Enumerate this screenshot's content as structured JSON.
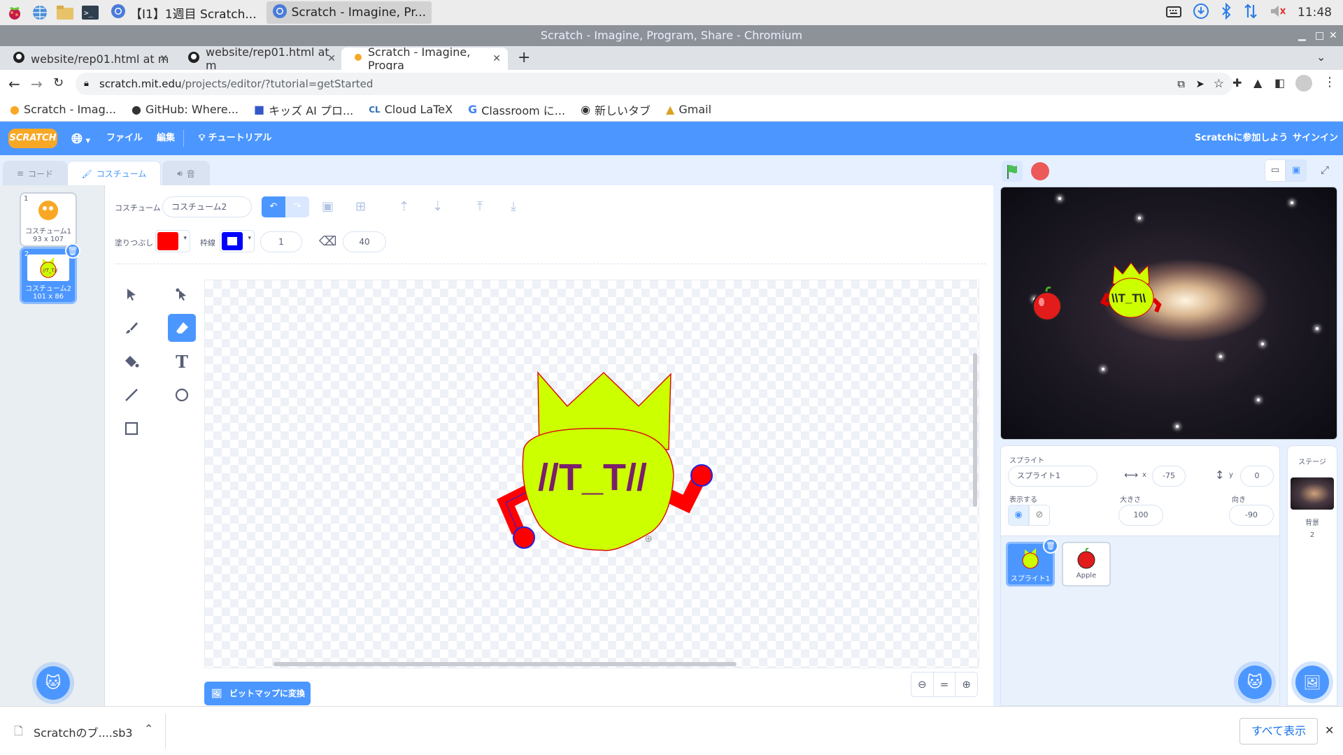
{
  "os": {
    "tasks": [
      "【I1】1週目 Scratch...",
      "Scratch - Imagine, Pr..."
    ],
    "clock": "11:48"
  },
  "window": {
    "title": "Scratch - Imagine, Program, Share - Chromium"
  },
  "tabs": [
    {
      "label": "website/rep01.html at m"
    },
    {
      "label": "website/rep01.html at m"
    },
    {
      "label": "Scratch - Imagine, Progra"
    }
  ],
  "address": {
    "host": "scratch.mit.edu",
    "path": "/projects/editor/?tutorial=getStarted"
  },
  "bookmarks": [
    "Scratch - Imag...",
    "GitHub: Where...",
    "キッズ AI プロ...",
    "Cloud LaTeX",
    "Classroom に...",
    "新しいタブ",
    "Gmail"
  ],
  "menu": {
    "logo": "SCRATCH",
    "file": "ファイル",
    "edit": "編集",
    "tutorial": "チュートリアル",
    "join": "Scratchに参加しよう",
    "signin": "サインイン"
  },
  "editor_tabs": {
    "code": "コード",
    "costume": "コスチューム",
    "sound": "音"
  },
  "costumes": [
    {
      "num": "1",
      "name": "コスチューム1",
      "size": "93 x 107"
    },
    {
      "num": "2",
      "name": "コスチューム2",
      "size": "101 x 86"
    }
  ],
  "paint": {
    "costume_label": "コスチューム",
    "costume_name": "コスチューム2",
    "fill_label": "塗りつぶし",
    "outline_label": "枠線",
    "outline_width": "1",
    "eraser_size": "40",
    "convert_button": "ビットマップに変換",
    "fill_color": "#ff0000",
    "outline_color": "#0000ff",
    "face_text": "//T_T//"
  },
  "stage": {
    "sprite_text": "\\\\T_T\\\\"
  },
  "sprite_info": {
    "sprite_label": "スプライト",
    "sprite_name": "スプライト1",
    "x_label": "x",
    "x": "-75",
    "y_label": "y",
    "y": "0",
    "show_label": "表示する",
    "size_label": "大きさ",
    "size": "100",
    "direction_label": "向き",
    "direction": "-90"
  },
  "sprites": [
    {
      "name": "スプライト1"
    },
    {
      "name": "Apple"
    }
  ],
  "stage_pane": {
    "title": "ステージ",
    "backdrop_label": "背景",
    "backdrop_count": "2"
  },
  "downloads": {
    "file": "Scratchのブ....sb3",
    "show_all": "すべて表示"
  }
}
